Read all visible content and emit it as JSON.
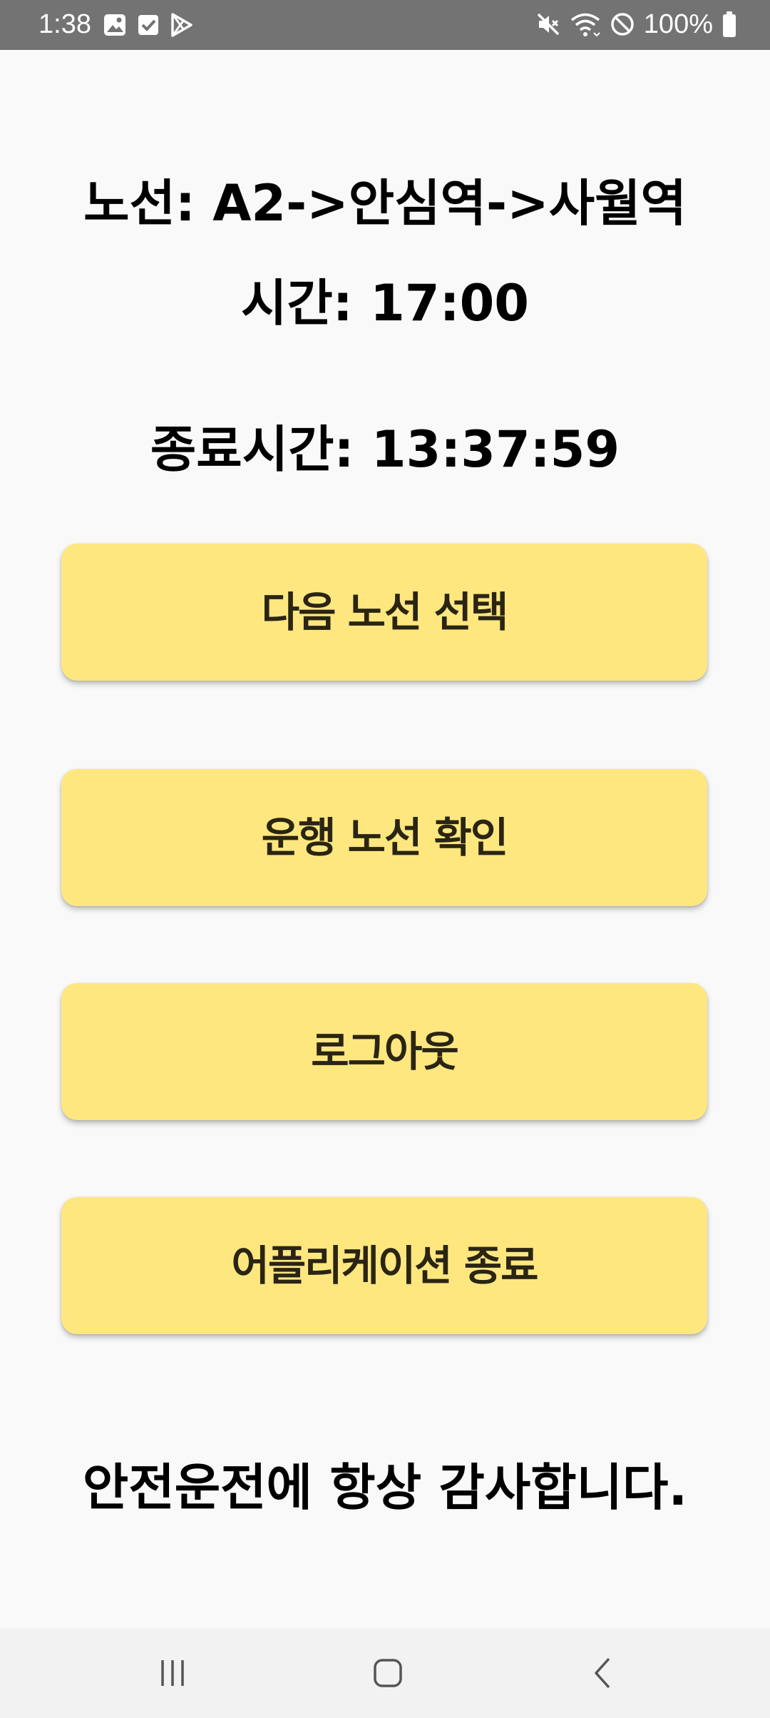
{
  "status_bar": {
    "time": "1:38",
    "left_icons": [
      "image-icon",
      "checkbox-icon",
      "play-store-icon"
    ],
    "right_icons": [
      "mute-icon",
      "wifi-icon",
      "do-not-disturb-icon",
      "battery-icon"
    ],
    "battery": "100%"
  },
  "info": {
    "route": "노선: A2->안심역->사월역",
    "time": "시간: 17:00",
    "end_time": "종료시간: 13:37:59"
  },
  "buttons": {
    "next_route": "다음 노선 선택",
    "check_route": "운행 노선 확인",
    "logout": "로그아웃",
    "exit_app": "어플리케이션 종료"
  },
  "footer": {
    "message": "안전운전에 항상 감사합니다."
  },
  "nav_bar": {
    "icons": [
      "recents-icon",
      "home-icon",
      "back-icon"
    ]
  },
  "colors": {
    "button_bg": "#ffe780",
    "button_text": "#2a2513",
    "background": "#f9f9f9",
    "status_bar": "#737373"
  }
}
